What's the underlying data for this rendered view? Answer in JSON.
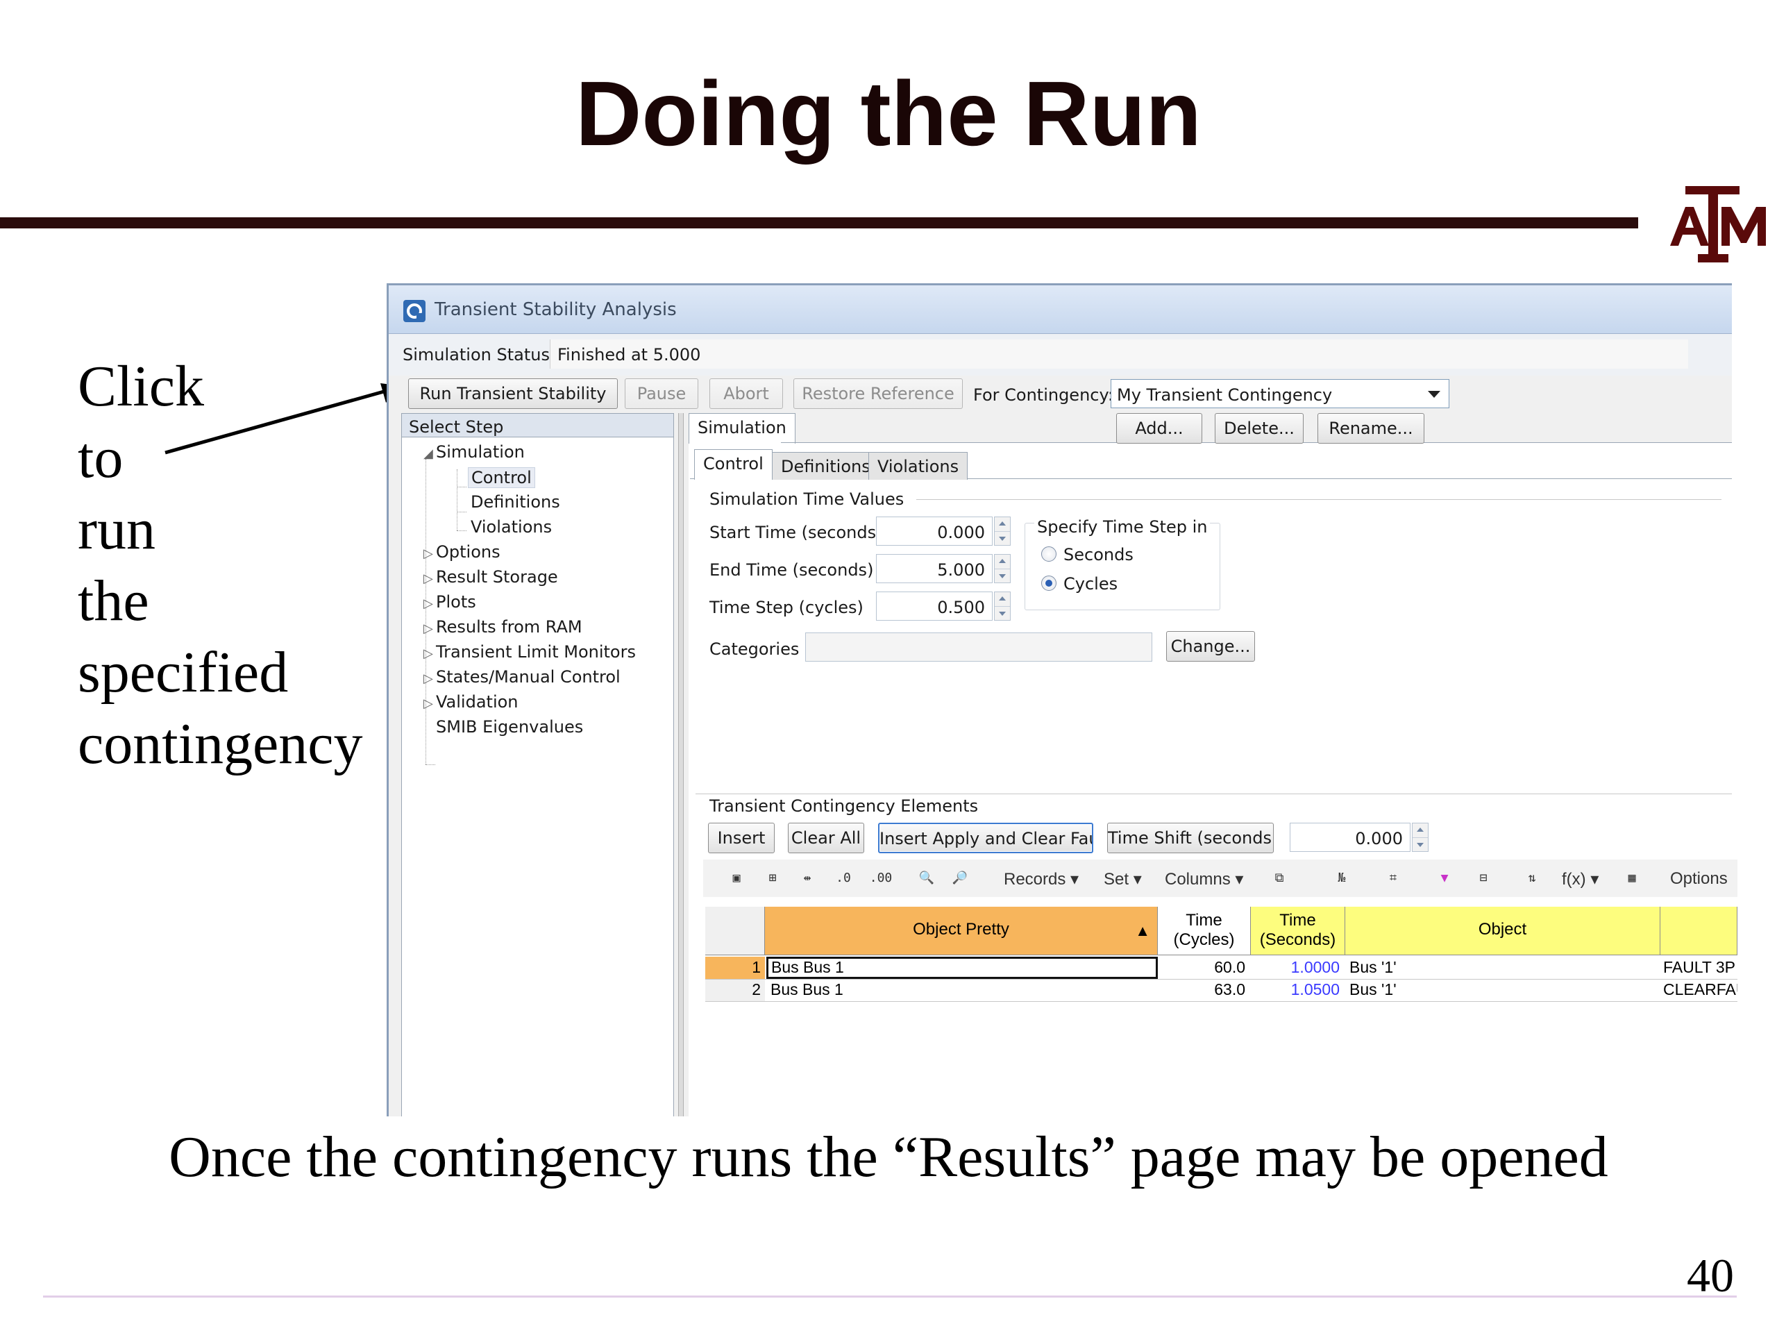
{
  "slide": {
    "title": "Doing the Run",
    "logo_text": "ATM",
    "click_lines": [
      "Click",
      "to",
      "run",
      "the",
      "specified",
      "contingency"
    ],
    "caption": "Once the contingency runs the “Results” page may be opened",
    "page_number": "40"
  },
  "window": {
    "title": "Transient Stability Analysis",
    "status_label": "Simulation Status",
    "status_value": "Finished at 5.000",
    "buttons": {
      "run": "Run Transient Stability",
      "pause": "Pause",
      "abort": "Abort",
      "restore": "Restore Reference",
      "add": "Add...",
      "delete": "Delete...",
      "rename": "Rename..."
    },
    "contingency_label": "For Contingency:",
    "contingency_value": "My Transient Contingency",
    "select_step_label": "Select Step",
    "tree": {
      "simulation": "Simulation",
      "control": "Control",
      "definitions": "Definitions",
      "violations": "Violations",
      "options": "Options",
      "result_storage": "Result Storage",
      "plots": "Plots",
      "results_ram": "Results from RAM",
      "limit_monitors": "Transient Limit Monitors",
      "states_manual": "States/Manual Control",
      "validation": "Validation",
      "smib": "SMIB Eigenvalues"
    },
    "outer_tab": "Simulation",
    "tabs": {
      "control": "Control",
      "definitions": "Definitions",
      "violations": "Violations"
    },
    "sim_time_values_label": "Simulation Time Values",
    "start_time": {
      "label": "Start Time (seconds)",
      "value": "0.000"
    },
    "end_time": {
      "label": "End Time (seconds)",
      "value": "5.000"
    },
    "time_step": {
      "label": "Time Step (cycles)",
      "value": "0.500"
    },
    "step_group": {
      "label": "Specify Time Step in",
      "seconds": "Seconds",
      "cycles": "Cycles",
      "selected": "Cycles"
    },
    "categories": {
      "label": "Categories",
      "value": "",
      "button": "Change..."
    },
    "elements_label": "Transient Contingency Elements",
    "element_buttons": {
      "insert": "Insert",
      "clear_all": "Clear All",
      "insert_apply_clear": "Insert Apply and Clear Fault",
      "time_shift": "Time Shift (seconds)"
    },
    "time_shift_value": "0.000",
    "toolbar": {
      "records": "Records",
      "set": "Set",
      "columns": "Columns",
      "fx": "f(x)",
      "options": "Options"
    },
    "grid": {
      "headers": [
        "Object Pretty",
        "Time\n(Cycles)",
        "Time\n(Seconds)",
        "Object",
        ""
      ],
      "rows": [
        {
          "num": "1",
          "object_pretty": "Bus Bus 1",
          "cycles": "60.0",
          "seconds": "1.0000",
          "object": "Bus '1'",
          "action": "FAULT 3P"
        },
        {
          "num": "2",
          "object_pretty": "Bus Bus 1",
          "cycles": "63.0",
          "seconds": "1.0500",
          "object": "Bus '1'",
          "action": "CLEARFAULT"
        }
      ]
    },
    "colors": {
      "selected_col": "#f7b55c",
      "header_yellow": "#fdfd7e",
      "link_blue": "#3a3aff"
    }
  }
}
